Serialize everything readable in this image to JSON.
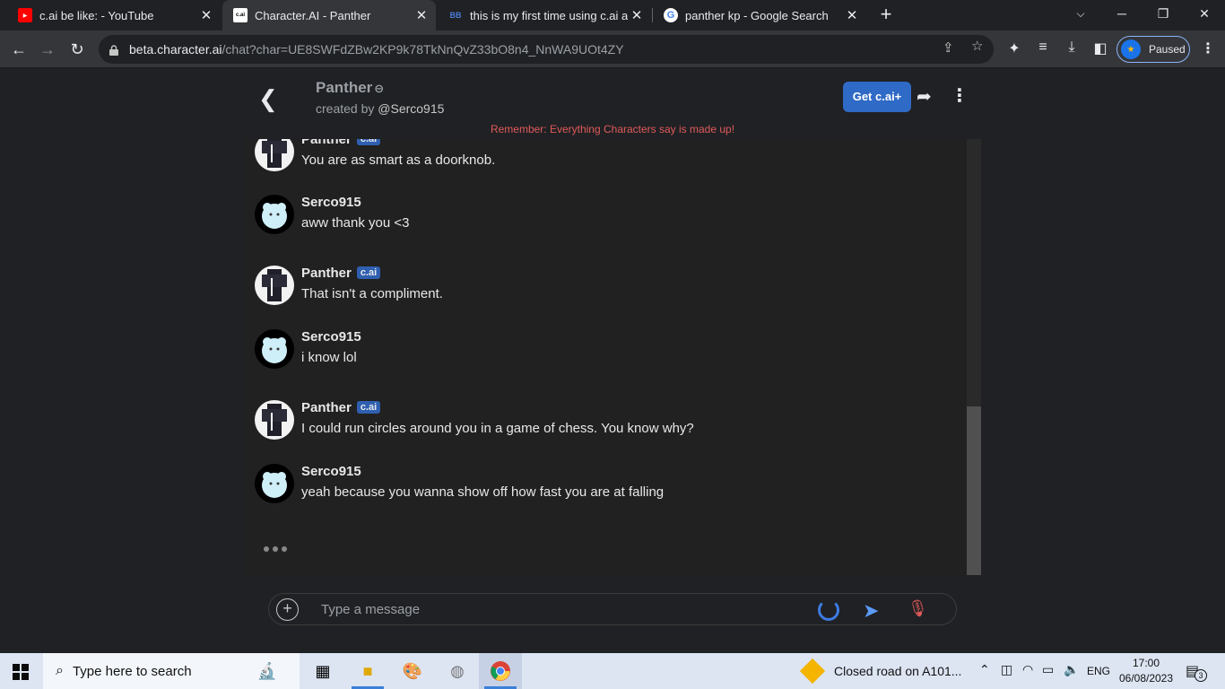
{
  "browser": {
    "tabs": [
      {
        "title": "c.ai be like: - YouTube",
        "favicon": "youtube-icon"
      },
      {
        "title": "Character.AI - Panther",
        "favicon": "cai-icon",
        "active": true
      },
      {
        "title": "this is my first time using c.ai and",
        "favicon": "bb-icon"
      },
      {
        "title": "panther kp - Google Search",
        "favicon": "google-icon"
      }
    ],
    "url_host": "beta.character.ai",
    "url_path": "/chat?char=UE8SWFdZBw2KP9k78TkNnQvZ33bO8n4_NnWA9UOt4ZY",
    "profile_label": "Paused"
  },
  "chat": {
    "character_name": "Panther",
    "created_by_prefix": "created by",
    "creator": "@Serco915",
    "get_plus_label": "Get c.ai+",
    "disclaimer": "Remember: Everything Characters say is made up!",
    "badge": "c.ai",
    "messages": [
      {
        "author": "Panther",
        "is_bot": true,
        "text": "You are as smart as a doorknob."
      },
      {
        "author": "Serco915",
        "is_bot": false,
        "text": "aww thank you <3"
      },
      {
        "author": "Panther",
        "is_bot": true,
        "text": "That isn't a compliment."
      },
      {
        "author": "Serco915",
        "is_bot": false,
        "text": "i know lol"
      },
      {
        "author": "Panther",
        "is_bot": true,
        "text": "I could run circles around you in a game of chess. You know why?"
      },
      {
        "author": "Serco915",
        "is_bot": false,
        "text": "yeah because you wanna show off how fast you are at falling"
      }
    ],
    "input_placeholder": "Type a message"
  },
  "taskbar": {
    "search_placeholder": "Type here to search",
    "news": "Closed road on A101...",
    "language": "ENG",
    "time": "17:00",
    "date": "06/08/2023",
    "notification_count": "3"
  }
}
